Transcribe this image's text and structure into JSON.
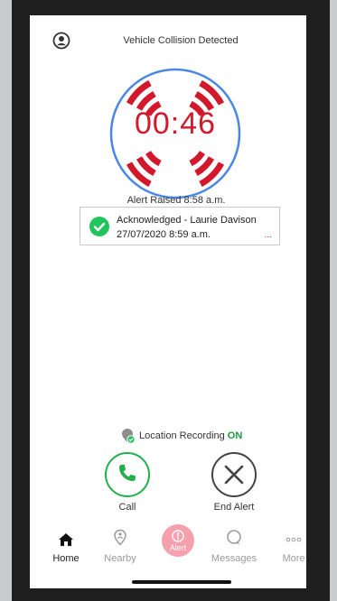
{
  "header": {
    "title": "Vehicle Collision Detected",
    "profile_icon": "user-circle-icon"
  },
  "timer": {
    "value": "00:46",
    "color": "#d2192c",
    "ring_color": "#4a86e8"
  },
  "alert": {
    "raised_text": "Alert Raised 8:58 a.m."
  },
  "acknowledgement": {
    "name_line": "Acknowledged - Laurie Davison",
    "time_line": "27/07/2020 8:59 a.m.",
    "more": "...",
    "check_color": "#22c45e"
  },
  "location": {
    "label": "Location Recording",
    "status": "ON",
    "status_color": "#1e9a3c"
  },
  "actions": {
    "call_label": "Call",
    "end_label": "End Alert"
  },
  "nav": {
    "items": [
      {
        "label": "Home",
        "icon": "home-icon",
        "active": true
      },
      {
        "label": "Nearby",
        "icon": "location-pin-icon",
        "active": false
      },
      {
        "label": "Alert",
        "icon": "alert-icon",
        "active": false
      },
      {
        "label": "Messages",
        "icon": "chat-bubble-icon",
        "active": false
      },
      {
        "label": "More",
        "icon": "more-dots-icon",
        "active": false
      }
    ]
  }
}
